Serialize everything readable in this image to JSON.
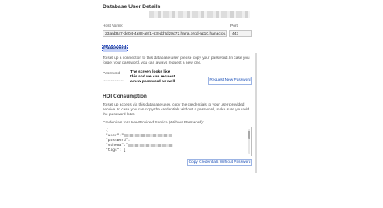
{
  "header": {
    "title": "Database User Details"
  },
  "connection": {
    "host_label": "Host Name:",
    "host_value": "23aab8a7-de04-4a83-a8f1-63edd7d29d72.hana.prod-ap10.hanaclou...",
    "port_label": "Port:",
    "port_value": "443"
  },
  "password_section": {
    "heading": "Password",
    "description": "To set up a connection to this database user, please copy your password. In case you forget your password, you can always request a new one.",
    "field_label": "Password:",
    "field_value": "••••••••••••••••",
    "annotation": "The screen looks like\nthis and we can request\na new password as well",
    "request_button": "Request New Password"
  },
  "hdi_section": {
    "heading": "HDI Consumption",
    "description": "To set up access via this database user, copy the credentials to your user-provided service. In case you can copy the credentials without a password, make sure you add the password later.",
    "credentials_label": "Credentials for User-Provided Service (Without Password):",
    "json_lines": [
      "{",
      "\"user\":\"",
      "\"password\":",
      "\"schema\":\"",
      "\"tags\": ["
    ],
    "copy_button": "Copy Credentials Without Password"
  },
  "icons": {
    "textarea_scrollbar": "scrollbar-icon"
  },
  "colors": {
    "accent": "#1a4fb8",
    "selected_heading_bg": "#c4d1f7"
  }
}
